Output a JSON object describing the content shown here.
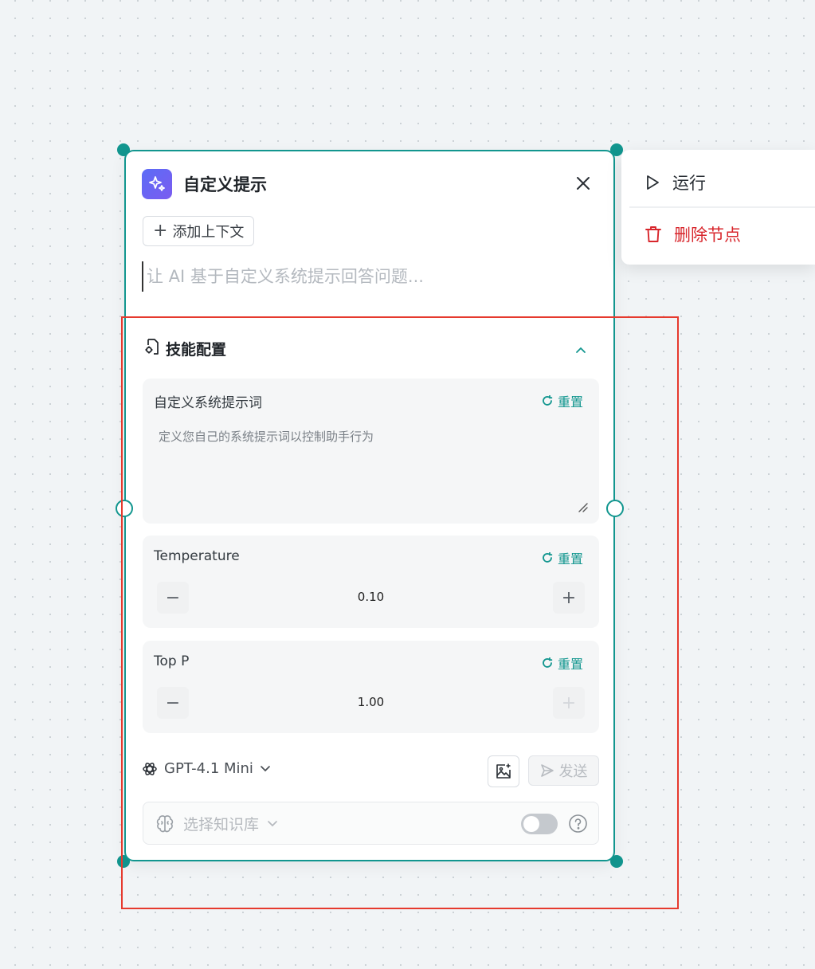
{
  "node": {
    "title": "自定义提示",
    "add_context_label": "添加上下文",
    "prompt_placeholder": "让 AI 基于自定义系统提示回答问题..."
  },
  "skills": {
    "title": "技能配置",
    "system_prompt": {
      "label": "自定义系统提示词",
      "reset_label": "重置",
      "placeholder": "定义您自己的系统提示词以控制助手行为",
      "value": ""
    },
    "temperature": {
      "label": "Temperature",
      "reset_label": "重置",
      "value": "0.10",
      "decrement": "−",
      "increment": "+"
    },
    "top_p": {
      "label": "Top P",
      "reset_label": "重置",
      "value": "1.00",
      "decrement": "−",
      "increment": "+"
    }
  },
  "footer": {
    "model": "GPT-4.1 Mini",
    "send_label": "发送",
    "knowledge_base_placeholder": "选择知识库",
    "knowledge_base_enabled": false
  },
  "context_menu": {
    "run_label": "运行",
    "delete_label": "删除节点"
  },
  "colors": {
    "accent": "#12968f",
    "danger": "#d8262c",
    "highlight_box": "#e63a2e",
    "node_icon": "#5b6cf6"
  },
  "icons": {
    "node": "sparkle-icon",
    "close": "close-icon",
    "skills": "gear-file-icon",
    "collapse": "chevron-up-icon",
    "reset": "refresh-icon",
    "model": "openai-logo-icon",
    "image": "image-add-icon",
    "send": "send-icon",
    "knowledge_base": "brain-icon",
    "help": "question-circle-icon",
    "run": "play-icon",
    "delete": "trash-icon"
  }
}
